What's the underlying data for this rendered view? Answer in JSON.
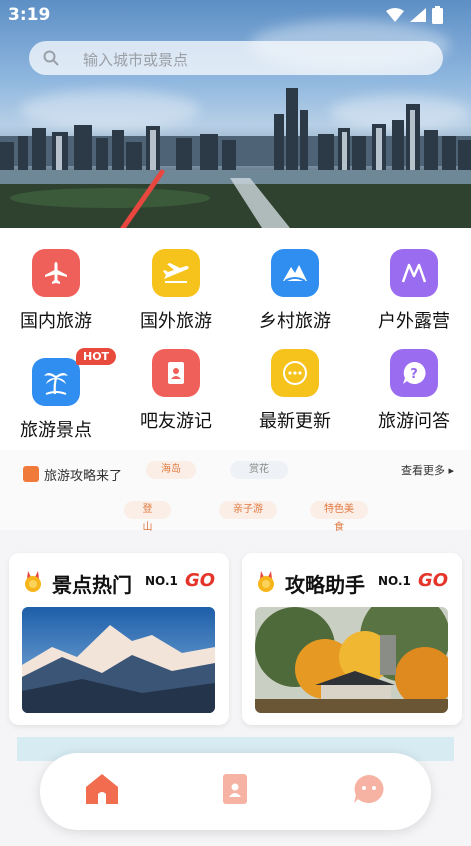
{
  "status_bar": {
    "time": "3:19"
  },
  "search": {
    "placeholder": "输入城市或景点"
  },
  "categories": [
    {
      "label": "国内旅游",
      "icon": "airplane-icon",
      "color": "#f0605a"
    },
    {
      "label": "国外旅游",
      "icon": "airplane-takeoff-icon",
      "color": "#f6c21c"
    },
    {
      "label": "乡村旅游",
      "icon": "mountain-icon",
      "color": "#2f8ef0"
    },
    {
      "label": "户外露营",
      "icon": "tent-icon",
      "color": "#9a6df0"
    },
    {
      "label": "旅游景点",
      "icon": "palm-tree-icon",
      "color": "#2f8ef0",
      "badge": "HOT"
    },
    {
      "label": "吧友游记",
      "icon": "notebook-icon",
      "color": "#f0605a"
    },
    {
      "label": "最新更新",
      "icon": "more-dots-icon",
      "color": "#f6c21c"
    },
    {
      "label": "旅游问答",
      "icon": "question-bubble-icon",
      "color": "#9a6df0"
    }
  ],
  "guides": {
    "title": "旅游攻略来了",
    "more": "查看更多 ▸",
    "chips": [
      "海岛",
      "赏花",
      "登山",
      "亲子游",
      "特色美食"
    ]
  },
  "cards": [
    {
      "title": "景点热门",
      "badge": "NO.1",
      "go": "GO"
    },
    {
      "title": "攻略助手",
      "badge": "NO.1",
      "go": "GO"
    }
  ],
  "bottom_nav": [
    {
      "icon": "home-icon",
      "active": true
    },
    {
      "icon": "contacts-book-icon",
      "active": false
    },
    {
      "icon": "chat-face-icon",
      "active": false
    }
  ],
  "colors": {
    "accent": "#f26d4f",
    "red": "#e84a3c"
  }
}
